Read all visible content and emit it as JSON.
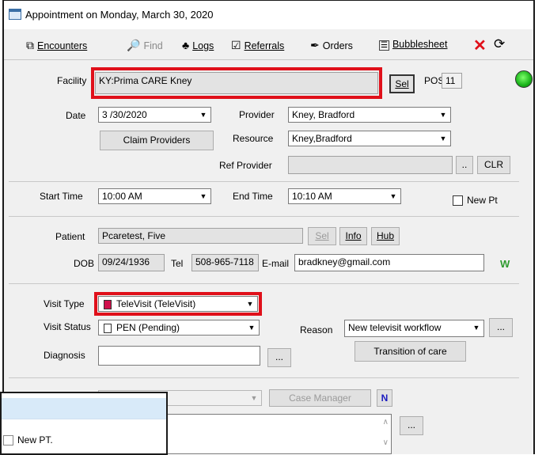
{
  "window": {
    "title": "Appointment on Monday, March 30, 2020"
  },
  "toolbar": {
    "encounters": "Encounters",
    "find": "Find",
    "logs": "Logs",
    "referrals": "Referrals",
    "orders": "Orders",
    "bubblesheet": "Bubblesheet"
  },
  "facility": {
    "label": "Facility",
    "value": "KY:Prima CARE Kney",
    "sel_button": "Sel",
    "pos_label": "POS",
    "pos_value": "11"
  },
  "date": {
    "label": "Date",
    "value": "3 /30/2020"
  },
  "provider": {
    "label": "Provider",
    "value": "Kney, Bradford"
  },
  "claim_providers_button": "Claim Providers",
  "resource": {
    "label": "Resource",
    "value": "Kney,Bradford"
  },
  "ref_provider": {
    "label": "Ref Provider",
    "value": "",
    "dots_button": "..",
    "clr_button": "CLR"
  },
  "start_time": {
    "label": "Start Time",
    "value": "10:00 AM"
  },
  "end_time": {
    "label": "End Time",
    "value": "10:10 AM"
  },
  "new_pt": {
    "label": "New Pt",
    "checked": false
  },
  "patient": {
    "label": "Patient",
    "value": "Pcaretest, Five",
    "sel_button": "Sel",
    "info_button": "Info",
    "hub_button": "Hub"
  },
  "dob": {
    "label": "DOB",
    "value": "09/24/1936"
  },
  "tel": {
    "label": "Tel",
    "value": "508-965-7118"
  },
  "email": {
    "label": "E-mail",
    "value": "bradkney@gmail.com"
  },
  "w_badge": "W",
  "visit_type": {
    "label": "Visit Type",
    "value": "TeleVisit (TeleVisit)",
    "swatch_color": "#d0104c"
  },
  "visit_status": {
    "label": "Visit Status",
    "value": "PEN (Pending)"
  },
  "reason": {
    "label": "Reason",
    "value": "New televisit workflow",
    "dots_button": "..."
  },
  "transition_button": "Transition of care",
  "diagnosis": {
    "label": "Diagnosis",
    "value": "",
    "dots_button": "..."
  },
  "case_manager_button": "Case Manager",
  "n_badge": "N",
  "notes_dots_button": "...",
  "overlay": {
    "new_pt_label": "New PT."
  },
  "colors": {
    "highlight_red": "#e0101a",
    "status_green": "#2fd02f"
  }
}
